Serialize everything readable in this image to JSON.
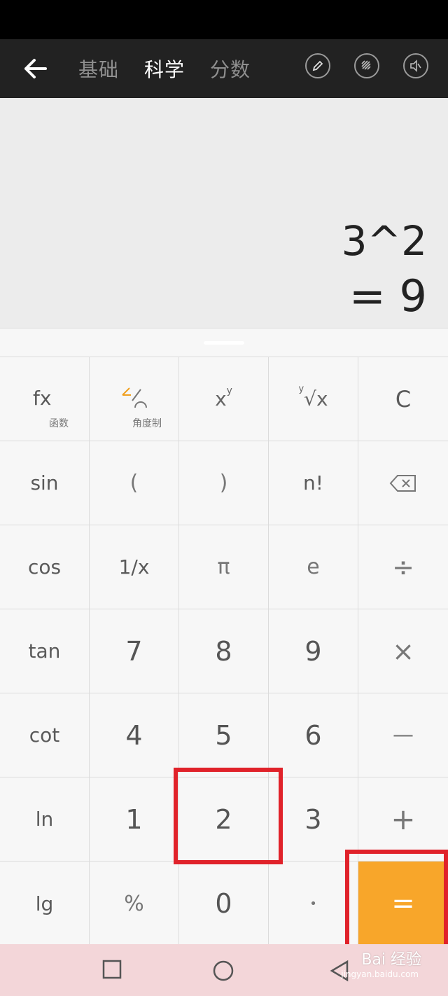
{
  "tabs": [
    "基础",
    "科学",
    "分数"
  ],
  "active_tab": "科学",
  "display": {
    "expression": "3^2",
    "result": "= 9"
  },
  "keys": {
    "fx": "fx",
    "fx_sub": "函数",
    "angle_sub": "角度制",
    "power_base": "x",
    "power_exp": "y",
    "root_idx": "y",
    "root_sym": "√x",
    "clear": "C",
    "sin": "sin",
    "lparen": "(",
    "rparen": ")",
    "factorial": "n!",
    "cos": "cos",
    "recip": "1/x",
    "pi": "π",
    "e": "e",
    "divide": "÷",
    "tan": "tan",
    "k7": "7",
    "k8": "8",
    "k9": "9",
    "multiply": "×",
    "cot": "cot",
    "k4": "4",
    "k5": "5",
    "k6": "6",
    "minus": "—",
    "ln": "ln",
    "k1": "1",
    "k2": "2",
    "k3": "3",
    "plus": "+",
    "lg": "lg",
    "percent": "%",
    "k0": "0",
    "dot": "•",
    "equals": "="
  },
  "colors": {
    "accent": "#f8a62a",
    "highlight": "#e0222a",
    "topbar": "#222222"
  },
  "icons": [
    "back-arrow-icon",
    "pencil-icon",
    "theme-icon",
    "mute-icon",
    "backspace-icon",
    "square-icon",
    "circle-icon",
    "triangle-icon"
  ],
  "watermark": {
    "brand": "Bai 经验",
    "url": "jingyan.baidu.com"
  }
}
